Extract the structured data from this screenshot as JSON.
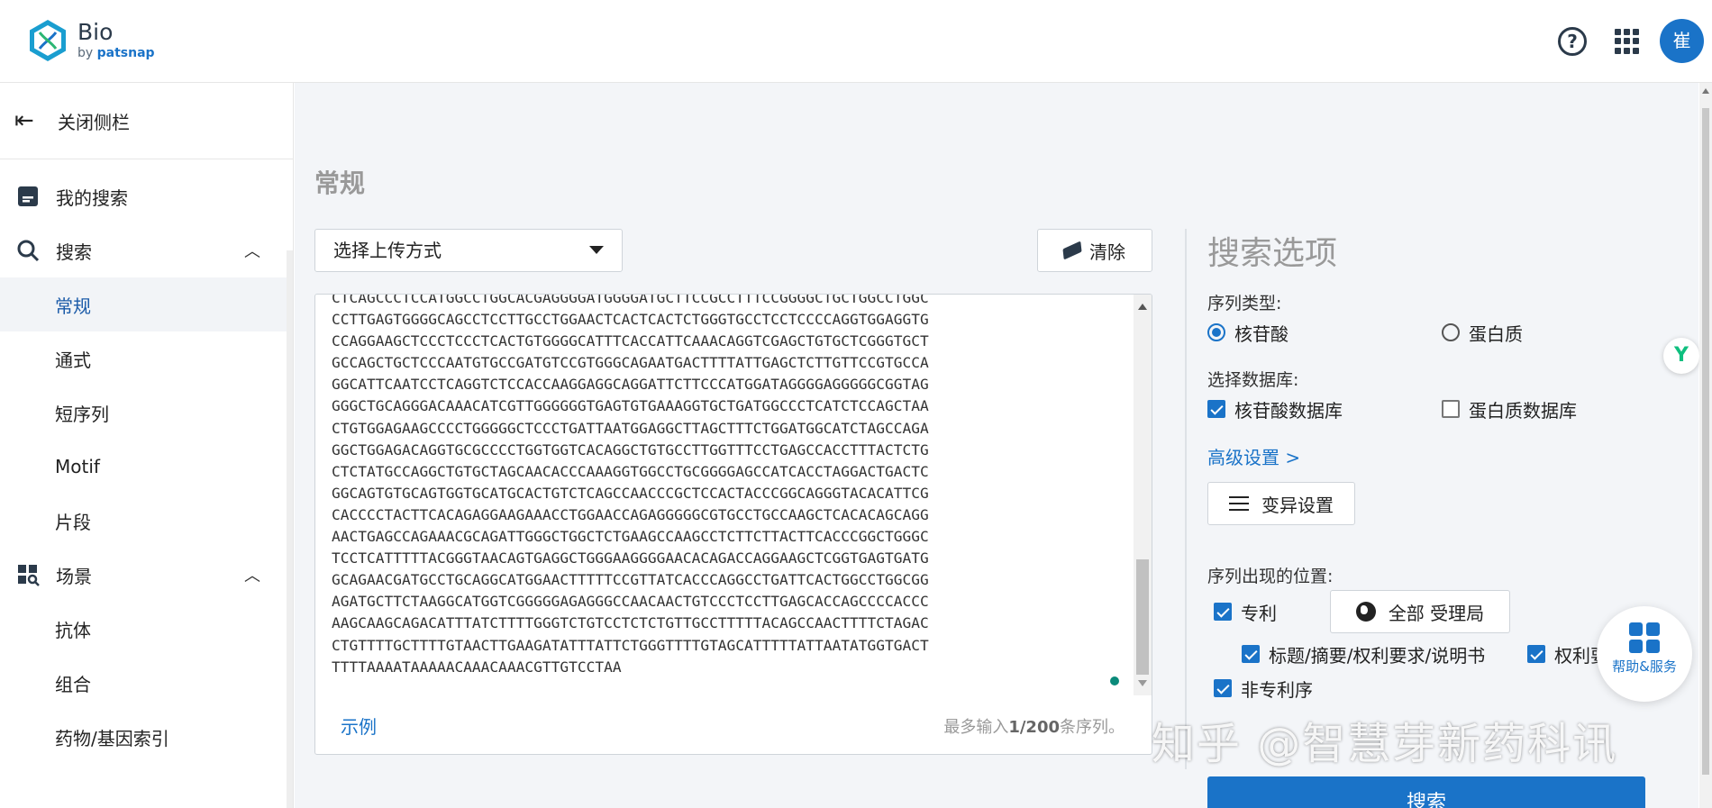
{
  "brand": {
    "name": "Bio",
    "sub_prefix": "by ",
    "sub_brand": "patsnap"
  },
  "header": {
    "help_icon": "question-circle-icon",
    "apps_icon": "grid-apps-icon",
    "avatar_text": "崔"
  },
  "sidebar": {
    "close_label": "关闭侧栏",
    "my_searches": "我的搜索",
    "search": {
      "label": "搜索",
      "items": [
        "常规",
        "通式",
        "短序列",
        "Motif",
        "片段"
      ],
      "active": "常规"
    },
    "scenes": {
      "label": "场景",
      "items": [
        "抗体",
        "组合",
        "药物/基因索引"
      ]
    }
  },
  "main": {
    "heading": "常规",
    "upload_select": "选择上传方式",
    "clear_button": "清除",
    "sequence_lines": [
      "CTCAGCCCTCCATGGCCTGGCACGAGGGGATGGGGATGCTTCCGCCTTTCCGGGGCTGCTGGCCTGGC",
      "CCTTGAGTGGGGCAGCCTCCTTGCCTGGAACTCACTCACTCTGGGTGCCTCCTCCCCAGGTGGAGGTG",
      "CCAGGAAGCTCCCTCCCTCACTGTGGGGCATTTCACCATTCAAACAGGTCGAGCTGTGCTCGGGTGCT",
      "GCCAGCTGCTCCCAATGTGCCGATGTCCGTGGGCAGAATGACTTTTATTGAGCTCTTGTTCCGTGCCA",
      "GGCATTCAATCCTCAGGTCTCCACCAAGGAGGCAGGATTCTTCCCATGGATAGGGGAGGGGGCGGTAG",
      "GGGCTGCAGGGACAAACATCGTTGGGGGGTGAGTGTGAAAGGTGCTGATGGCCCTCATCTCCAGCTAA",
      "CTGTGGAGAAGCCCCTGGGGGCTCCCTGATTAATGGAGGCTTAGCTTTCTGGATGGCATCTAGCCAGA",
      "GGCTGGAGACAGGTGCGCCCCTGGTGGTCACAGGCTGTGCCTTGGTTTCCTGAGCCACCTTTACTCTG",
      "CTCTATGCCAGGCTGTGCTAGCAACACCCAAAGGTGGCCTGCGGGGAGCCATCACCTAGGACTGACTC",
      "GGCAGTGTGCAGTGGTGCATGCACTGTCTCAGCCAACCCGCTCCACTACCCGGCAGGGTACACATTCG",
      "CACCCCTACTTCACAGAGGAAGAAACCTGGAACCAGAGGGGGCGTGCCTGCCAAGCTCACACAGCAGG",
      "AACTGAGCCAGAAACGCAGATTGGGCTGGCTCTGAAGCCAAGCCTCTTCTTACTTCACCCGGCTGGGC",
      "TCCTCATTTTTACGGGTAACAGTGAGGCTGGGAAGGGGAACACAGACCAGGAAGCTCGGTGAGTGATG",
      "GCAGAACGATGCCTGCAGGCATGGAACTTTTTCCGTTATCACCCAGGCCTGATTCACTGGCCTGGCGG",
      "AGATGCTTCTAAGGCATGGTCGGGGGAGAGGGCCAACAACTGTCCCTCCTTGAGCACCAGCCCCACCC",
      "AAGCAAGCAGACATTTATCTTTTGGGTCTGTCCTCTCTGTTGCCTTTTTACAGCCAACTTTTCTAGAC",
      "CTGTTTTGCTTTTGTAACTTGAAGATATTTATTCTGGGTTTTGTAGCATTTTTATTAATATGGTGACT",
      "TTTTAAAATAAAAACAAACAAACGTTGTCCTAA"
    ],
    "example_link": "示例",
    "limit_prefix": "最多输入",
    "limit_value": "1/200",
    "limit_suffix": "条序列。"
  },
  "options": {
    "title": "搜索选项",
    "seq_type_label": "序列类型:",
    "seq_type_nucleotide": "核苷酸",
    "seq_type_protein": "蛋白质",
    "db_label": "选择数据库:",
    "db_nucleotide": "核苷酸数据库",
    "db_protein": "蛋白质数据库",
    "advanced_link": "高级设置 >",
    "variation_button": "变异设置",
    "position_label": "序列出现的位置:",
    "patent": "专利",
    "office_button": "全部 受理局",
    "title_abstract": "标题/摘要/权利要求/说明书",
    "claims_partial": "权利要",
    "non_patent_partial": "非专利序",
    "search_button": "搜索"
  },
  "widgets": {
    "help_service": "帮助&服务",
    "side_badge_icon": "y-logo-icon"
  },
  "watermark": "知乎 @智慧芽新药科讯",
  "colors": {
    "primary": "#1a73c8",
    "heading_gray": "#999999",
    "main_bg": "#f3f5f8"
  }
}
